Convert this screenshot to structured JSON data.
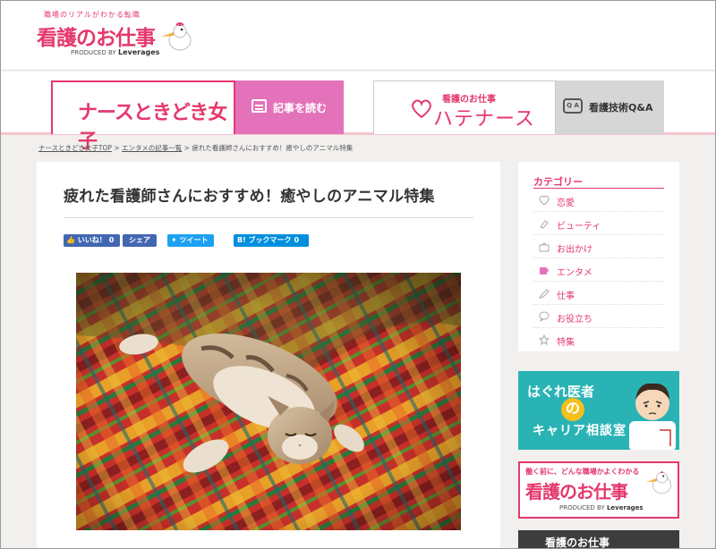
{
  "header": {
    "logo_tagline": "職場のリアルがわかる転職",
    "logo_title": "看護のお仕事",
    "logo_produced": "PRODUCED BY",
    "logo_company": "Leverages"
  },
  "nav": {
    "nurse_site_title": "ナースときどき女子",
    "read_articles_label": "記事を読む",
    "hate_sub": "看護のお仕事",
    "hate_main": "ハテナース",
    "qa_label": "看護技術Q&A",
    "qa_icon_text": "Q A"
  },
  "breadcrumb": {
    "items": [
      "ナースときどき女子TOP",
      "エンタメの記事一覧",
      "疲れた看護師さんにおすすめ！癒やしのアニマル特集"
    ],
    "separator": ">"
  },
  "article": {
    "title": "疲れた看護師さんにおすすめ！癒やしのアニマル特集",
    "like_label": "いいね！",
    "like_count": "0",
    "share_label": "シェア",
    "tweet_label": "ツイート",
    "hatena_label": "B! ブックマーク",
    "hatena_count": "0"
  },
  "sidebar": {
    "category_title": "カテゴリー",
    "categories": [
      {
        "label": "恋愛",
        "icon": "heart-icon"
      },
      {
        "label": "ビューティ",
        "icon": "lipstick-icon"
      },
      {
        "label": "お出かけ",
        "icon": "bag-icon"
      },
      {
        "label": "エンタメ",
        "icon": "cup-icon"
      },
      {
        "label": "仕事",
        "icon": "pen-icon"
      },
      {
        "label": "お役立ち",
        "icon": "chat-icon"
      },
      {
        "label": "特集",
        "icon": "star-icon"
      }
    ]
  },
  "banners": {
    "doctor_line1": "はぐれ医者",
    "doctor_no": "の",
    "doctor_line2": "キャリア相談室",
    "job_top": "働く前に、どんな職場かよくわかる",
    "job_main": "看護のお仕事",
    "job_produced": "PRODUCED BY",
    "job_company": "Leverages",
    "dark_label": "看護のお仕事"
  },
  "colors": {
    "brand_pink": "#e5386d",
    "nav_magenta": "#e472ba",
    "facebook": "#4267b2",
    "twitter": "#1da1f2",
    "hatena": "#008fde",
    "teal_banner": "#2ab3b4"
  }
}
